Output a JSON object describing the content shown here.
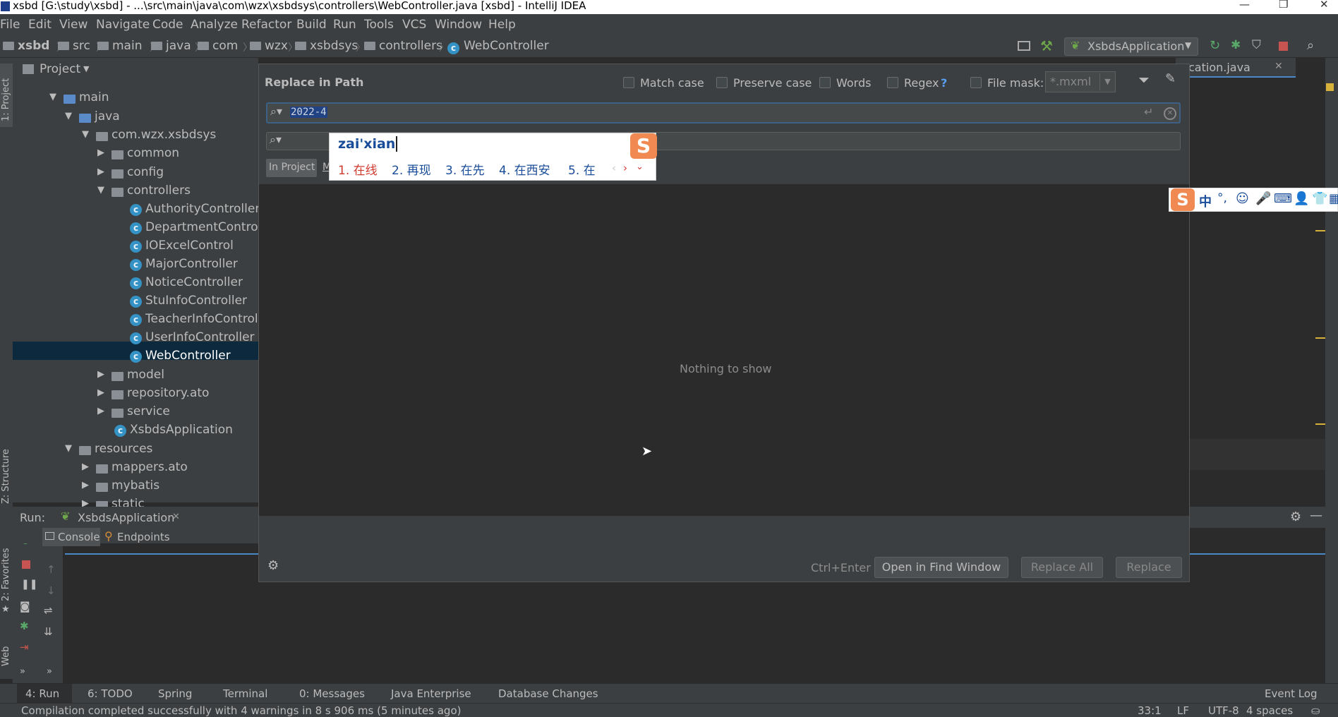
{
  "window": {
    "title": "xsbd [G:\\study\\xsbd] - ...\\src\\main\\java\\com\\wzx\\xsbdsys\\controllers\\WebController.java [xsbd] - IntelliJ IDEA"
  },
  "menu": [
    "File",
    "Edit",
    "View",
    "Navigate",
    "Code",
    "Analyze",
    "Refactor",
    "Build",
    "Run",
    "Tools",
    "VCS",
    "Window",
    "Help"
  ],
  "breadcrumbs": [
    "xsbd",
    "src",
    "main",
    "java",
    "com",
    "wzx",
    "xsbdsys",
    "controllers",
    "WebController"
  ],
  "run_config": "XsbdsApplication",
  "left_stripe": {
    "project": "1: Project",
    "structure": "Z: Structure",
    "favorites": "2: Favorites",
    "web": "Web"
  },
  "project_panel": {
    "title": "Project",
    "tree": [
      {
        "label": "main",
        "depth": 1
      },
      {
        "label": "java",
        "depth": 2
      },
      {
        "label": "com.wzx.xsbdsys",
        "depth": 3
      },
      {
        "label": "common",
        "depth": 4
      },
      {
        "label": "config",
        "depth": 4
      },
      {
        "label": "controllers",
        "depth": 4
      },
      {
        "label": "AuthorityController",
        "depth": 5
      },
      {
        "label": "DepartmentController",
        "depth": 5
      },
      {
        "label": "IOExcelControl",
        "depth": 5
      },
      {
        "label": "MajorController",
        "depth": 5
      },
      {
        "label": "NoticeController",
        "depth": 5
      },
      {
        "label": "StuInfoController",
        "depth": 5
      },
      {
        "label": "TeacherInfoController",
        "depth": 5
      },
      {
        "label": "UserInfoController",
        "depth": 5
      },
      {
        "label": "WebController",
        "depth": 5
      },
      {
        "label": "model",
        "depth": 4
      },
      {
        "label": "repository.ato",
        "depth": 4
      },
      {
        "label": "service",
        "depth": 4
      },
      {
        "label": "XsbdsApplication",
        "depth": 4
      },
      {
        "label": "resources",
        "depth": 2
      },
      {
        "label": "mappers.ato",
        "depth": 3
      },
      {
        "label": "mybatis",
        "depth": 3
      },
      {
        "label": "static",
        "depth": 3
      }
    ]
  },
  "editor_tab": "cation.java",
  "run_panel": {
    "label": "Run:",
    "config_tab": "XsbdsApplication",
    "tabs": [
      "Console",
      "Endpoints"
    ]
  },
  "dialog": {
    "title": "Replace in Path",
    "options": {
      "match_case": "Match case",
      "preserve_case": "Preserve case",
      "words": "Words",
      "regex": "Regex",
      "regex_help": "?",
      "file_mask": "File mask:"
    },
    "file_mask_value": "*.mxml",
    "search_value": "2022-4",
    "scope_tab": "In Project",
    "scope_tab_2": "M",
    "empty_message": "Nothing to show",
    "shortcut_hint": "Ctrl+Enter",
    "buttons": {
      "open_in_find": "Open in Find Window",
      "replace_all": "Replace All",
      "replace": "Replace"
    }
  },
  "ime": {
    "composition": "zai'xian",
    "candidates": [
      "1. 在线",
      "2. 再现",
      "3. 在先",
      "4. 在西安",
      "5. 在"
    ],
    "toolbar_label": "中"
  },
  "bottom_tools": [
    "4: Run",
    "6: TODO",
    "Spring",
    "Terminal",
    "0: Messages",
    "Java Enterprise",
    "Database Changes"
  ],
  "event_log": "Event Log",
  "status": {
    "message": "Compilation completed successfully with 4 warnings in 8 s 906 ms (5 minutes ago)",
    "position": "33:1",
    "line_sep": "LF",
    "encoding": "UTF-8",
    "indent": "4 spaces"
  },
  "colors": {
    "accent": "#3592c4",
    "selection": "#0d293e",
    "dialog_bg": "#3c3f41",
    "editor_bg": "#2b2b2b"
  }
}
